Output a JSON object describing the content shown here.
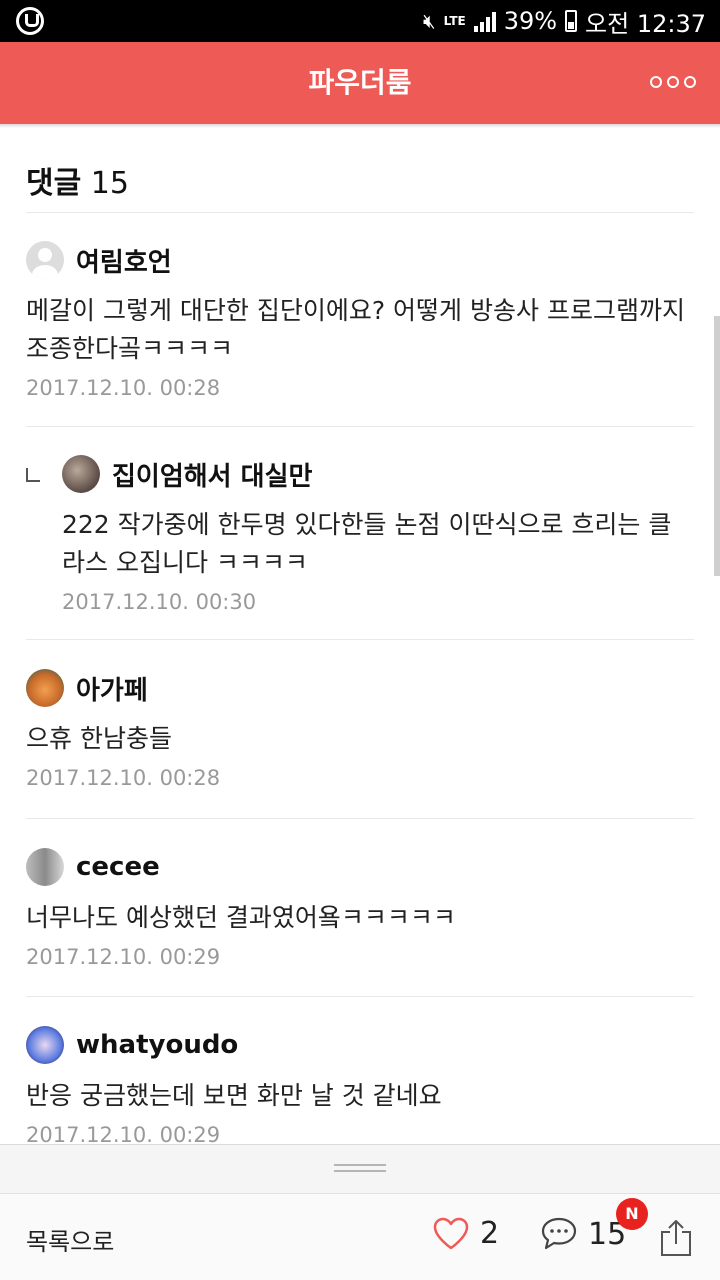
{
  "status_bar": {
    "network": "LTE",
    "battery": "39%",
    "time": "오전 12:37"
  },
  "header": {
    "title": "파우더룸"
  },
  "comments_section": {
    "label": "댓글",
    "count": "15"
  },
  "comments": [
    {
      "user": "여림호언",
      "text": "메갈이 그렇게 대단한 집단이에요? 어떻게 방송사 프로그램까지 조종한다곸ㅋㅋㅋㅋ",
      "date": "2017.12.10. 00:28",
      "is_reply": false,
      "avatar": "default-avatar-icon"
    },
    {
      "user": "집이엄해서 대실만",
      "text": "222 작가중에 한두명 있다한들 논점 이딴식으로 흐리는 클라스 오집니다 ㅋㅋㅋㅋ",
      "date": "2017.12.10. 00:30",
      "is_reply": true,
      "avatar": "profile-photo"
    },
    {
      "user": "아가페",
      "text": "으휴 한남충들",
      "date": "2017.12.10. 00:28",
      "is_reply": false,
      "avatar": "profile-photo"
    },
    {
      "user": "cecee",
      "text": "너무나도 예상했던 결과였어욬ㅋㅋㅋㅋㅋ",
      "date": "2017.12.10. 00:29",
      "is_reply": false,
      "avatar": "profile-photo"
    },
    {
      "user": "whatyoudo",
      "text": "반응 궁금했는데 보면 화만 날 것 같네요",
      "date": "2017.12.10. 00:29",
      "is_reply": false,
      "avatar": "profile-photo"
    }
  ],
  "bottom_bar": {
    "list_label": "목록으로",
    "like_count": "2",
    "comment_count": "15",
    "new_badge": "N"
  },
  "colors": {
    "accent": "#ee5a56",
    "badge": "#e8231f"
  }
}
